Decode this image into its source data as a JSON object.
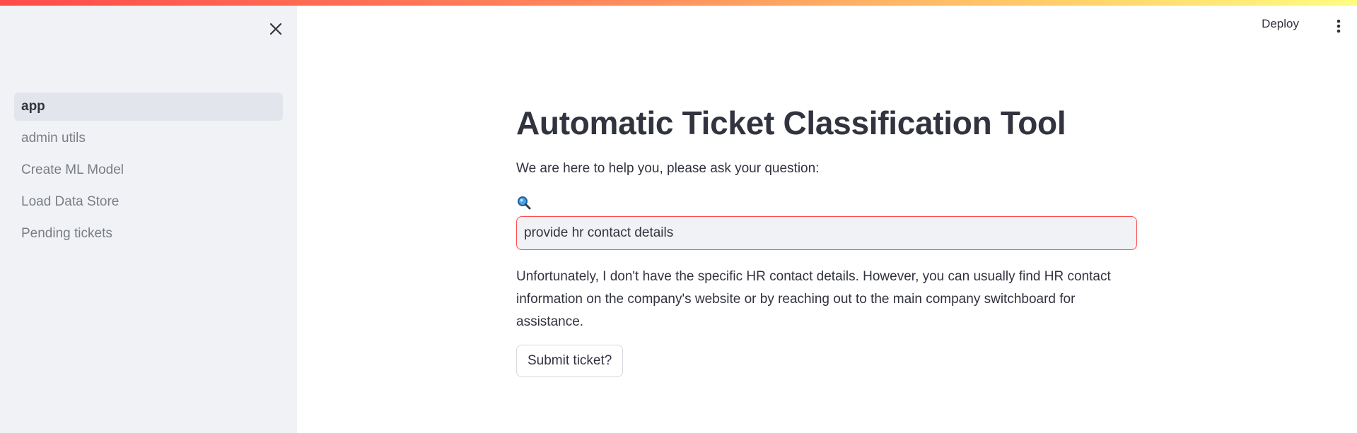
{
  "header": {
    "deploy_label": "Deploy",
    "menu_icon": "kebab-menu-icon"
  },
  "sidebar": {
    "close_icon": "close-icon",
    "items": [
      {
        "label": "app",
        "active": true
      },
      {
        "label": "admin utils",
        "active": false
      },
      {
        "label": "Create ML Model",
        "active": false
      },
      {
        "label": "Load Data Store",
        "active": false
      },
      {
        "label": "Pending tickets",
        "active": false
      }
    ]
  },
  "main": {
    "title": "Automatic Ticket Classification Tool",
    "subtitle": "We are here to help you, please ask your question:",
    "search_icon": "magnifier-icon",
    "question_value": "provide hr contact details",
    "response": "Unfortunately, I don't have the specific HR contact details. However, you can usually find HR contact information on the company's website or by reaching out to the main company switchboard for assistance.",
    "submit_label": "Submit ticket?"
  },
  "colors": {
    "accent": "#ff4b4b",
    "sidebar_bg": "#f0f2f6",
    "text": "#31333f",
    "muted_text": "#7a7d87"
  }
}
